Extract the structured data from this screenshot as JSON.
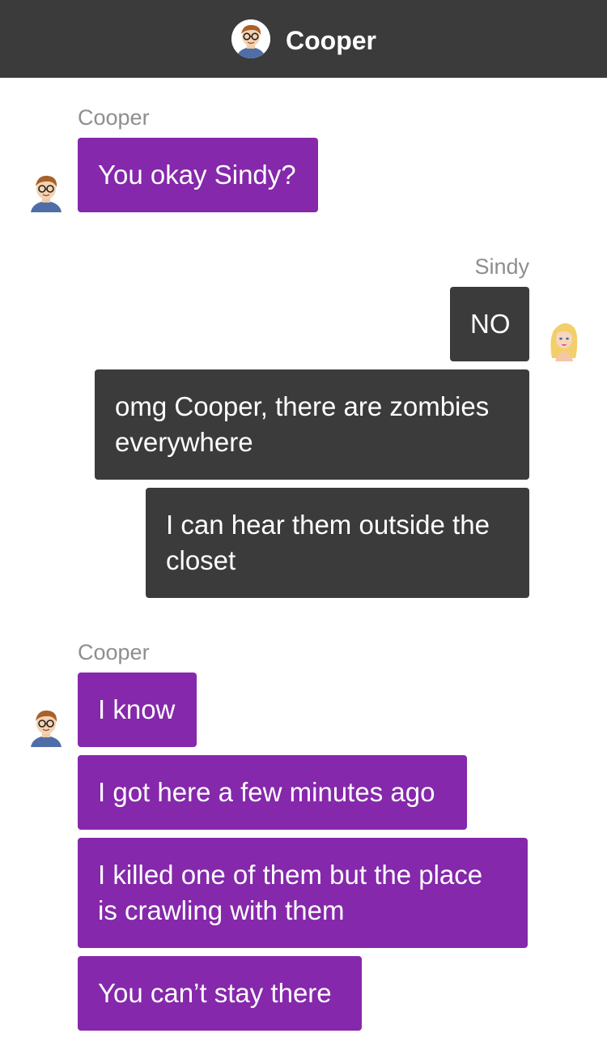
{
  "header": {
    "title": "Cooper",
    "avatar_icon": "cooper-avatar-icon"
  },
  "colors": {
    "header_bg": "#3b3b3b",
    "cooper_bubble": "#8528ab",
    "sindy_bubble": "#3b3b3b",
    "sender_label": "#8e8e8e"
  },
  "groups": [
    {
      "sender": "Cooper",
      "avatar_icon": "cooper-avatar-icon",
      "messages": [
        "You okay Sindy?"
      ]
    },
    {
      "sender": "Sindy",
      "avatar_icon": "sindy-avatar-icon",
      "messages": [
        "NO",
        "omg Cooper, there are zombies everywhere",
        "I can hear them outside the closet"
      ]
    },
    {
      "sender": "Cooper",
      "avatar_icon": "cooper-avatar-icon",
      "messages": [
        "I know",
        "I got here a few minutes ago",
        "I killed one of them but the place is crawling with them",
        "You can’t stay there"
      ]
    }
  ]
}
